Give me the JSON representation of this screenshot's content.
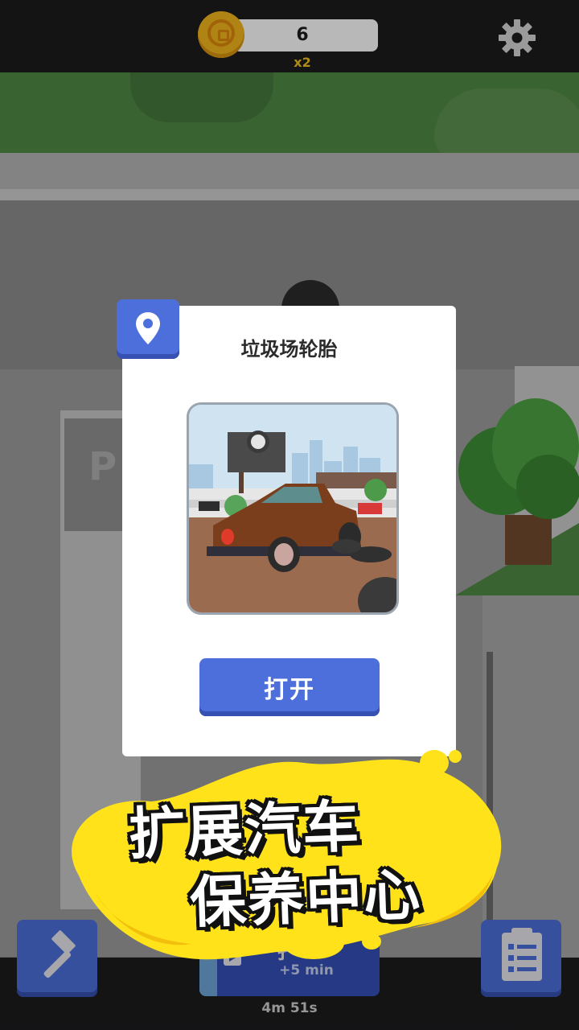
{
  "hud": {
    "coins": "6",
    "multiplier": "x2"
  },
  "dialog": {
    "title": "垃圾场轮胎",
    "open_label": "打开"
  },
  "banner": {
    "line1": "扩展汽车",
    "line2": "保养中心"
  },
  "boost": {
    "label": "扌",
    "sub": "+5 min"
  },
  "timer": "4m 51s",
  "colors": {
    "accent_blue": "#4d6fdc",
    "coin_gold": "#f4b81c",
    "banner_yellow": "#ffe21a",
    "bar_dark": "#1c1c1e"
  },
  "icons": {
    "settings": "gear-icon",
    "pin": "location-pin-icon",
    "build": "hammer-icon",
    "tasks": "clipboard-list-icon",
    "ad": "play-icon",
    "currency": "coin-icon"
  }
}
